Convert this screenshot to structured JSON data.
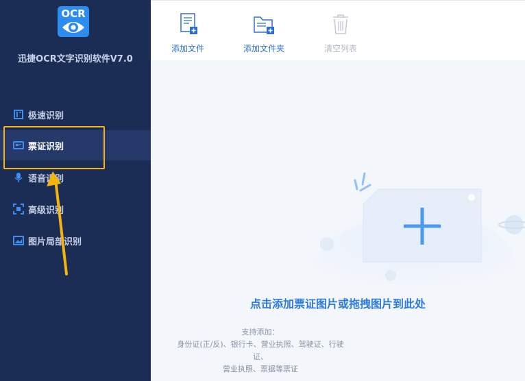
{
  "app": {
    "logo_text": "OCR",
    "title": "迅捷OCR文字识别软件V7.0"
  },
  "sidebar": {
    "items": [
      {
        "label": "极速识别",
        "icon": "quick-scan-icon"
      },
      {
        "label": "票证识别",
        "icon": "ticket-card-icon",
        "active": true
      },
      {
        "label": "语音识别",
        "icon": "microphone-icon"
      },
      {
        "label": "高级识别",
        "icon": "advanced-scan-icon"
      },
      {
        "label": "图片局部识别",
        "icon": "image-crop-icon"
      }
    ]
  },
  "toolbar": {
    "add_file": "添加文件",
    "add_folder": "添加文件夹",
    "clear_list": "清空列表"
  },
  "drop_zone": {
    "title": "点击添加票证图片或拖拽图片到此处",
    "support_label": "支持添加：",
    "support_line1": "身份证(正/反)、银行卡、营业执照、驾驶证、行驶证、",
    "support_line2": "营业执照、票据等票证"
  },
  "colors": {
    "sidebar_bg": "#1c2d55",
    "accent": "#2d8cf0",
    "highlight": "#f6b40e"
  }
}
